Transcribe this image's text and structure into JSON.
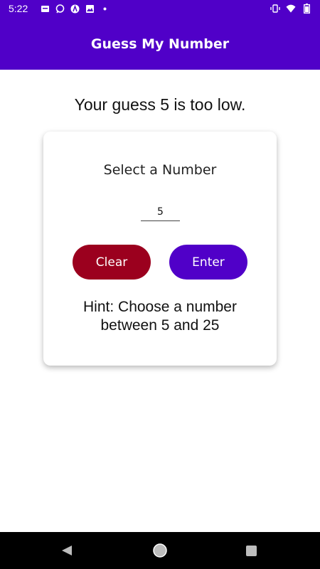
{
  "status_bar": {
    "time": "5:22",
    "left_icons": [
      "notification-icon",
      "message-icon",
      "app-icon",
      "image-icon",
      "dot-icon"
    ],
    "right_icons": [
      "vibrate-icon",
      "wifi-icon",
      "battery-icon"
    ]
  },
  "app_bar": {
    "title": "Guess My Number"
  },
  "result_text": "Your guess 5 is too low.",
  "card": {
    "title": "Select a Number",
    "input_value": "5",
    "clear_label": "Clear",
    "enter_label": "Enter",
    "hint_line1": "Hint: Choose a number",
    "hint_line2": "between 5 and 25"
  },
  "nav_bar": {
    "icons": [
      "back-icon",
      "home-icon",
      "recents-icon"
    ]
  },
  "colors": {
    "primary": "#5000c8",
    "clear": "#9b001e",
    "nav": "#000000"
  }
}
